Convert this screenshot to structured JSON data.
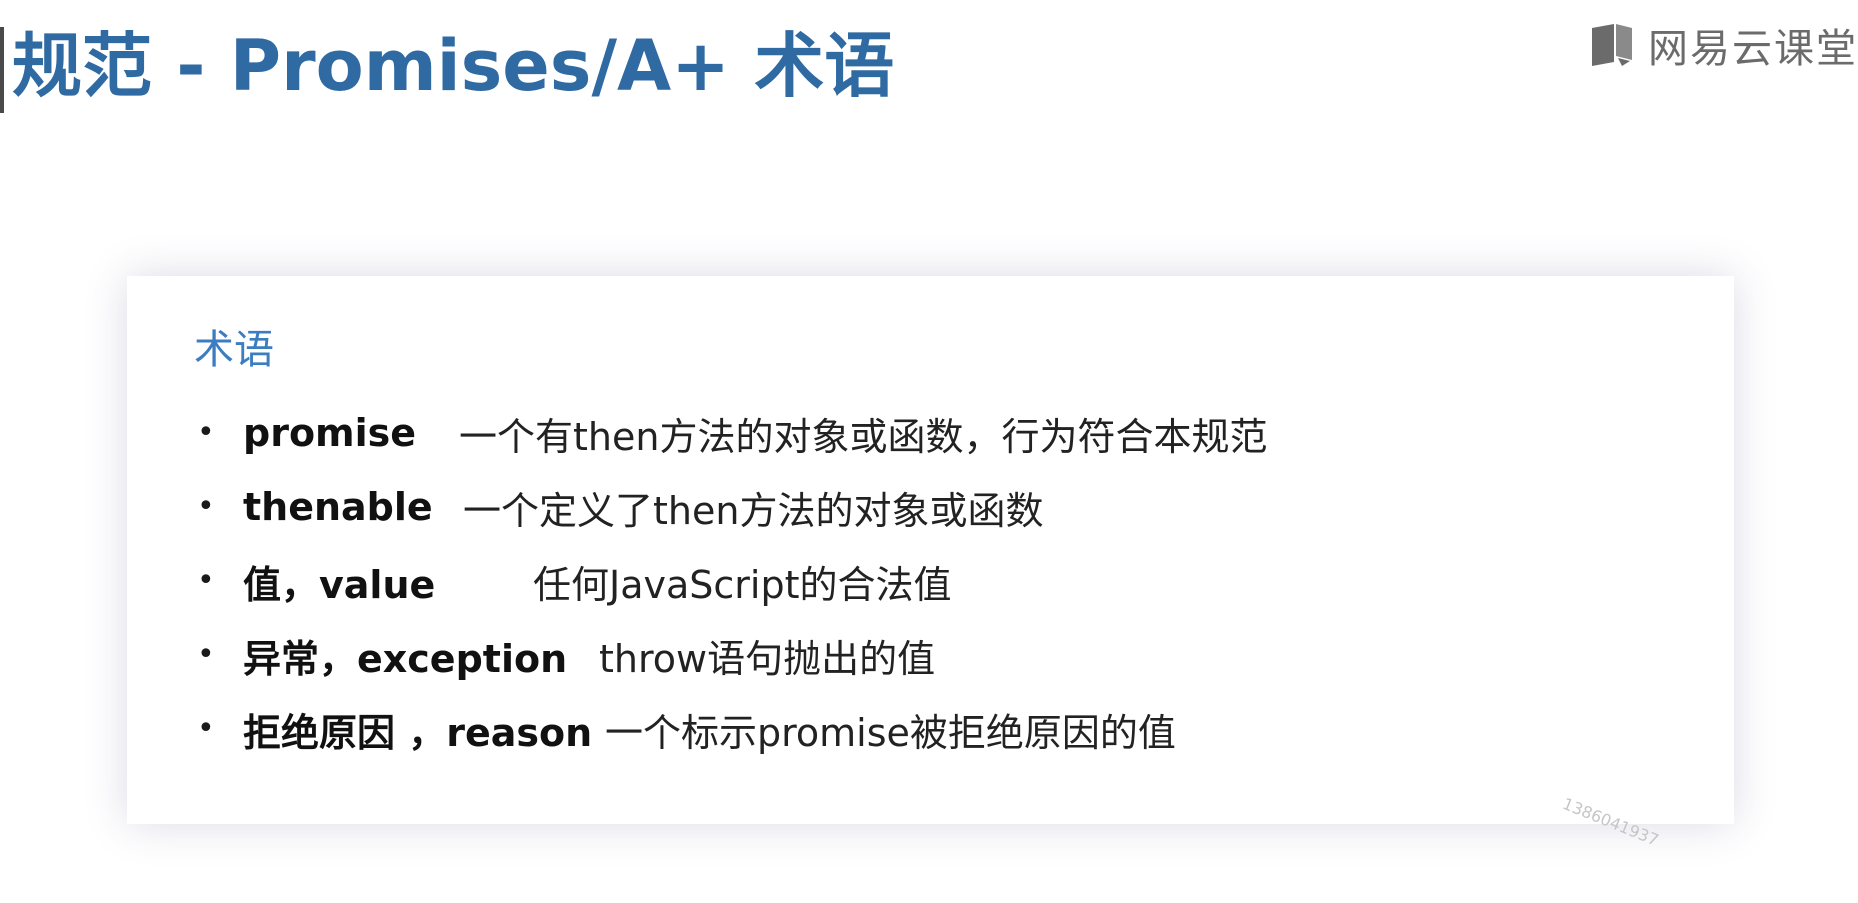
{
  "slide": {
    "title": "规范 - Promises/A+ 术语"
  },
  "brand": {
    "name": "网易云课堂",
    "icon": "book-icon"
  },
  "card": {
    "heading": "术语",
    "bullet": "•",
    "items": [
      {
        "term": "promise",
        "description": "一个有then方法的对象或函数，行为符合本规范"
      },
      {
        "term": "thenable",
        "description": "一个定义了then方法的对象或函数"
      },
      {
        "term": "值，value",
        "description": "任何JavaScript的合法值"
      },
      {
        "term": "异常，exception",
        "description": "throw语句抛出的值"
      },
      {
        "term": "拒绝原因 ，reason",
        "description": "一个标示promise被拒绝原因的值"
      }
    ],
    "watermark": "1386041937"
  },
  "colors": {
    "title": "#2f6aa3",
    "heading": "#3c7cc0",
    "brand_text": "#6b6b6b"
  }
}
